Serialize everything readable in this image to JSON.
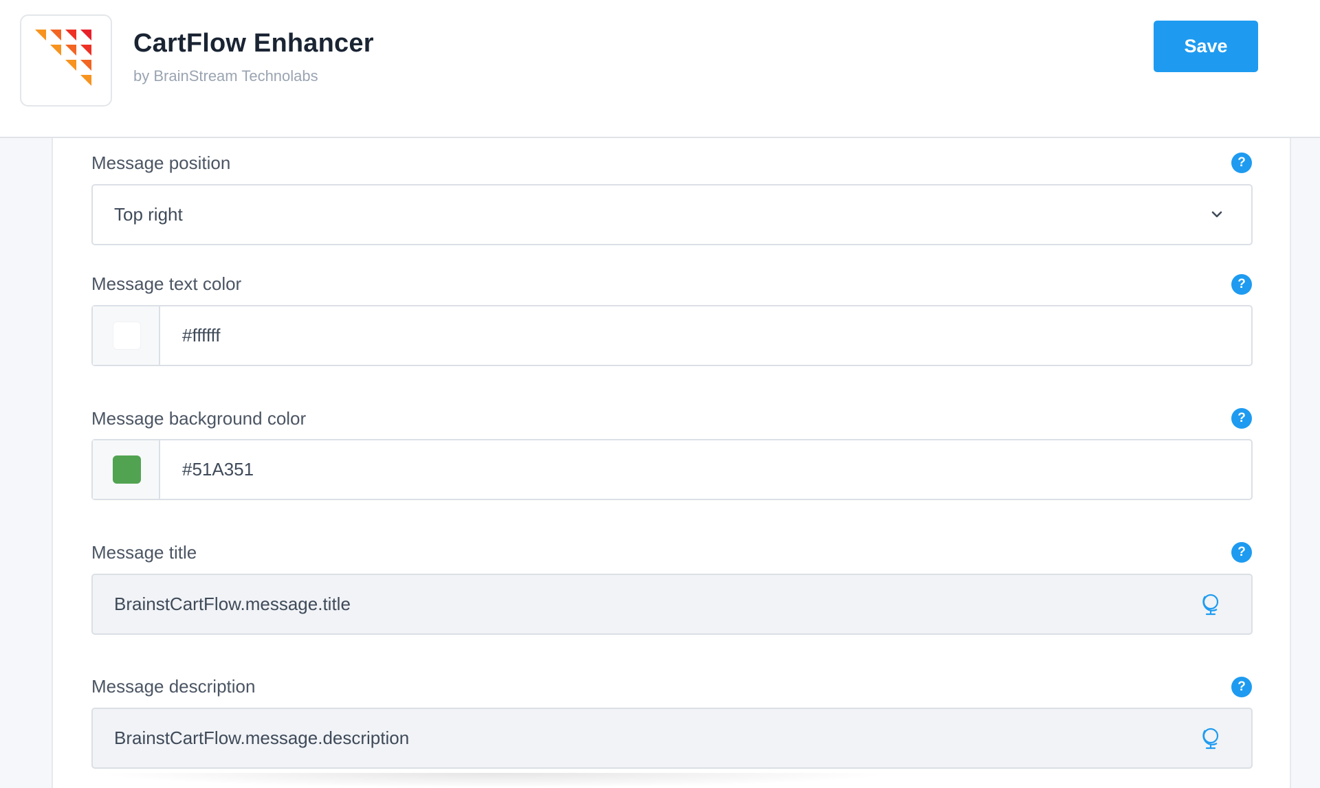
{
  "app": {
    "title": "CartFlow Enhancer",
    "vendor": "by BrainStream Technolabs",
    "save_label": "Save",
    "accent_color": "#1e9bf0"
  },
  "fields": {
    "position": {
      "label": "Message position",
      "value": "Top right",
      "icon": "chevron-down-icon"
    },
    "text_color": {
      "label": "Message text color",
      "value": "#ffffff",
      "swatch_color": "#ffffff"
    },
    "bg_color": {
      "label": "Message background color",
      "value": "#51A351",
      "swatch_color": "#51A351"
    },
    "title": {
      "label": "Message title",
      "value": "BrainstCartFlow.message.title",
      "icon": "globe-icon"
    },
    "description": {
      "label": "Message description",
      "value": "BrainstCartFlow.message.description",
      "icon": "globe-icon"
    }
  },
  "help_icon": "help-icon"
}
